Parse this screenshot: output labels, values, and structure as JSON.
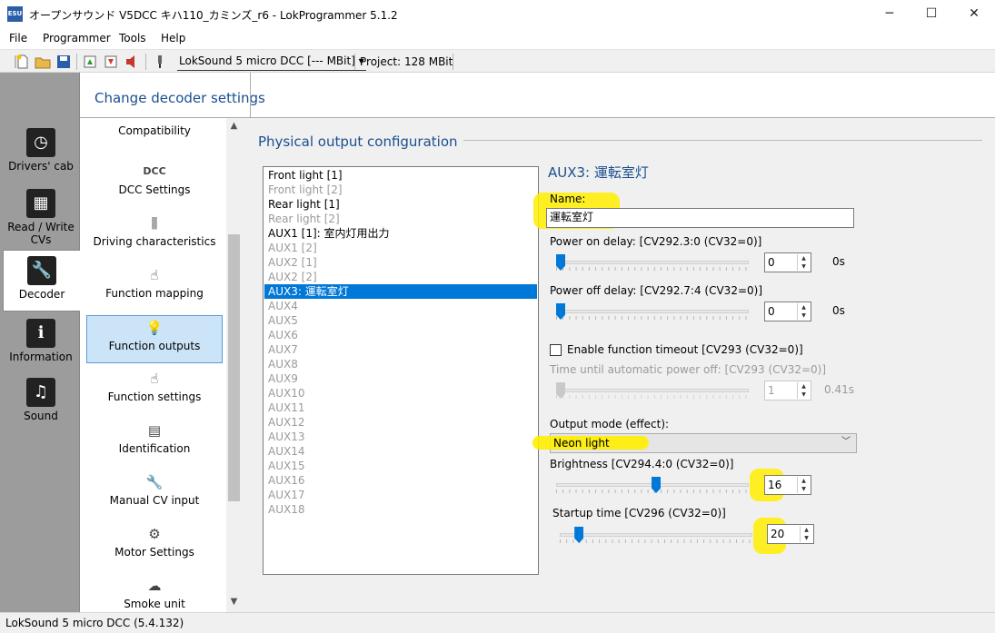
{
  "window": {
    "title": "オープンサウンド V5DCC キハ110_カミンズ_r6 - LokProgrammer 5.1.2",
    "app_icon": "ESU",
    "minimize": "─",
    "maximize": "☐",
    "close": "✕"
  },
  "menu": [
    "File",
    "Programmer",
    "Tools",
    "Help"
  ],
  "toolbar": {
    "decoder": "LokSound 5 micro DCC [--- MBit] ▾",
    "project_label": "Project:",
    "project_value": "128 MBit"
  },
  "leftnav": [
    {
      "label": "Drivers' cab",
      "icon": "drivers-cab-icon",
      "glyph": "◷"
    },
    {
      "label": "Read / Write CVs",
      "icon": "chip-icon",
      "glyph": "▦"
    },
    {
      "label": "Decoder",
      "icon": "wrench-icon",
      "glyph": "🔧"
    },
    {
      "label": "Information",
      "icon": "info-icon",
      "glyph": "ℹ"
    },
    {
      "label": "Sound",
      "icon": "music-note-icon",
      "glyph": "♫"
    }
  ],
  "header": {
    "title": "Change decoder settings"
  },
  "subnav": [
    {
      "label": "Compatibility",
      "glyph": "☝"
    },
    {
      "label": "DCC Settings",
      "glyph": "DCC"
    },
    {
      "label": "Driving characteristics",
      "glyph": "⫼"
    },
    {
      "label": "Function mapping",
      "glyph": "☝"
    },
    {
      "label": "Function outputs",
      "glyph": "💡"
    },
    {
      "label": "Function settings",
      "glyph": "☝"
    },
    {
      "label": "Identification",
      "glyph": "▤"
    },
    {
      "label": "Manual CV input",
      "glyph": "🔧"
    },
    {
      "label": "Motor Settings",
      "glyph": "⚙"
    },
    {
      "label": "Smoke unit",
      "glyph": "☁"
    }
  ],
  "scroll": {
    "up": "▲",
    "down": "▼"
  },
  "main": {
    "group_title": "Physical output configuration",
    "outputs": [
      {
        "label": "Front light [1]",
        "state": "enabled"
      },
      {
        "label": "Front light [2]",
        "state": "disabled"
      },
      {
        "label": "Rear light [1]",
        "state": "enabled"
      },
      {
        "label": "Rear light [2]",
        "state": "disabled"
      },
      {
        "label": "AUX1 [1]: 室内灯用出力",
        "state": "enabled"
      },
      {
        "label": "AUX1 [2]",
        "state": "disabled"
      },
      {
        "label": "AUX2 [1]",
        "state": "disabled"
      },
      {
        "label": "AUX2 [2]",
        "state": "disabled"
      },
      {
        "label": "AUX3: 運転室灯",
        "state": "selected"
      },
      {
        "label": "AUX4",
        "state": "disabled"
      },
      {
        "label": "AUX5",
        "state": "disabled"
      },
      {
        "label": "AUX6",
        "state": "disabled"
      },
      {
        "label": "AUX7",
        "state": "disabled"
      },
      {
        "label": "AUX8",
        "state": "disabled"
      },
      {
        "label": "AUX9",
        "state": "disabled"
      },
      {
        "label": "AUX10",
        "state": "disabled"
      },
      {
        "label": "AUX11",
        "state": "disabled"
      },
      {
        "label": "AUX12",
        "state": "disabled"
      },
      {
        "label": "AUX13",
        "state": "disabled"
      },
      {
        "label": "AUX14",
        "state": "disabled"
      },
      {
        "label": "AUX15",
        "state": "disabled"
      },
      {
        "label": "AUX16",
        "state": "disabled"
      },
      {
        "label": "AUX17",
        "state": "disabled"
      },
      {
        "label": "AUX18",
        "state": "disabled"
      }
    ]
  },
  "detail": {
    "title": "AUX3: 運転室灯",
    "name_label": "Name:",
    "name_value": "運転室灯",
    "power_on_label": "Power on delay: [CV292.3:0 (CV32=0)]",
    "power_on_value": "0",
    "power_on_level": 0,
    "power_on_unit": "0s",
    "power_off_label": "Power off delay: [CV292.7:4 (CV32=0)]",
    "power_off_value": "0",
    "power_off_level": 0,
    "power_off_unit": "0s",
    "timeout_label": "Enable function timeout [CV293 (CV32=0)]",
    "auto_off_label": "Time until automatic power off: [CV293 (CV32=0)]",
    "auto_off_value": "1",
    "auto_off_level": 0,
    "auto_off_unit": "0.41s",
    "mode_label": "Output mode (effect):",
    "mode_value": "Neon light",
    "mode_arrow": "﹀",
    "brightness_label": "Brightness [CV294.4:0 (CV32=0)]",
    "brightness_value": "16",
    "brightness_level": 0.52,
    "startup_label": "Startup time [CV296 (CV32=0)]",
    "startup_value": "20",
    "startup_level": 0.08
  },
  "spin": {
    "up": "▲",
    "down": "▼"
  },
  "status": "LokSound 5 micro DCC (5.4.132)",
  "colors": {
    "accent": "#0078d7",
    "heading": "#1a4f8f",
    "highlight": "#ffee00"
  }
}
